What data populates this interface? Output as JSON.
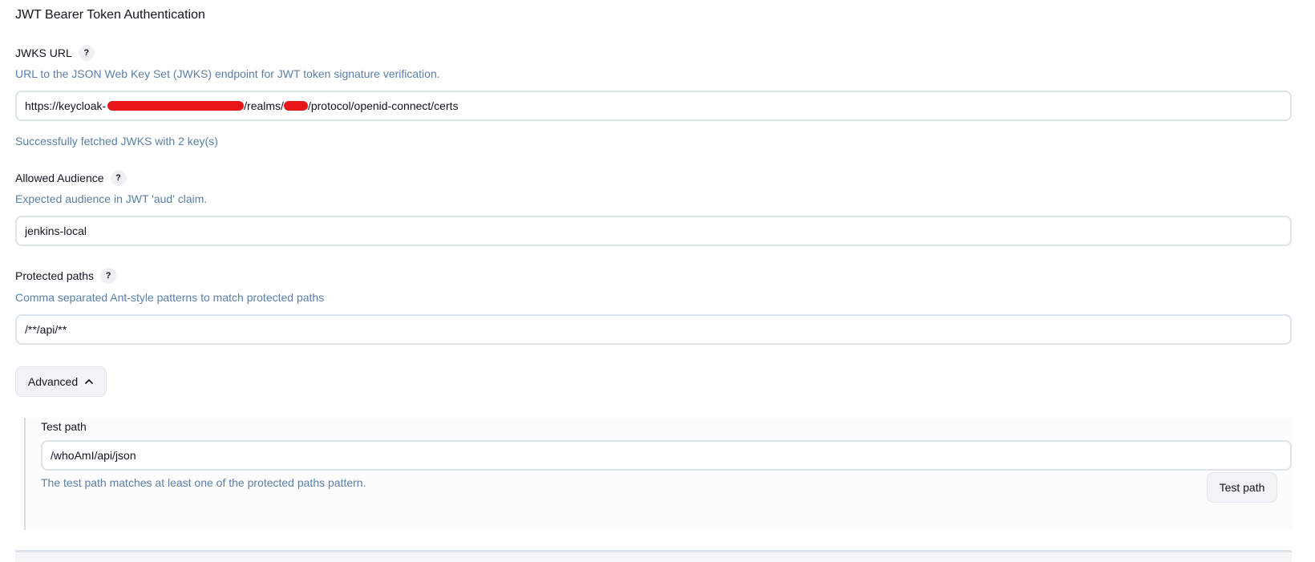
{
  "section": {
    "title": "JWT Bearer Token Authentication"
  },
  "jwks": {
    "label": "JWKS URL",
    "help": "?",
    "description": "URL to the JSON Web Key Set (JWKS) endpoint for JWT token signature verification.",
    "value_prefix": "https://keycloak-",
    "value_middle": "/realms/",
    "value_suffix": "/protocol/openid-connect/certs",
    "status": "Successfully fetched JWKS with 2 key(s)"
  },
  "audience": {
    "label": "Allowed Audience",
    "help": "?",
    "description": "Expected audience in JWT 'aud' claim.",
    "value": "jenkins-local"
  },
  "protected_paths": {
    "label": "Protected paths",
    "help": "?",
    "description": "Comma separated Ant-style patterns to match protected paths",
    "value": "/**/api/**"
  },
  "advanced": {
    "label": "Advanced"
  },
  "test_path": {
    "label": "Test path",
    "value": "/whoAmI/api/json",
    "message": "The test path matches at least one of the protected paths pattern.",
    "button_label": "Test path"
  },
  "colors": {
    "description_text": "#5a7fa8",
    "input_border": "#dde3ea",
    "redaction": "#e8151b"
  }
}
